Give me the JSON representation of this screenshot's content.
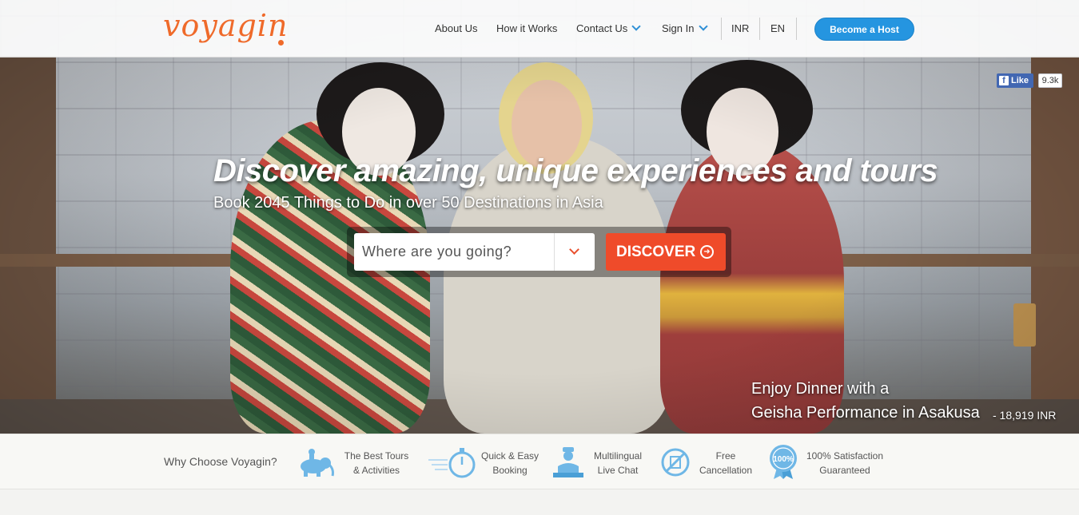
{
  "header": {
    "logo": "voyagin",
    "nav": {
      "about": "About Us",
      "how": "How it Works",
      "contact": "Contact Us",
      "sign_in": "Sign In",
      "currency": "INR",
      "language": "EN"
    },
    "host_button": "Become a Host"
  },
  "facebook": {
    "like_label": "Like",
    "count": "9.3k"
  },
  "hero": {
    "headline": "Discover amazing, unique experiences and tours",
    "subline": "Book 2045 Things to Do in over 50 Destinations in Asia",
    "search_placeholder": "Where are you going?",
    "discover_button": "DISCOVER",
    "caption_line1": "Enjoy Dinner with a",
    "caption_line2": "Geisha Performance in Asakusa",
    "caption_price": "- 18,919 INR"
  },
  "why": {
    "title": "Why Choose Voyagin?",
    "features": [
      {
        "line1": "The Best Tours",
        "line2": "& Activities",
        "icon": "elephant-icon"
      },
      {
        "line1": "Quick & Easy",
        "line2": "Booking",
        "icon": "stopwatch-icon"
      },
      {
        "line1": "Multilingual",
        "line2": "Live Chat",
        "icon": "concierge-icon"
      },
      {
        "line1": "Free",
        "line2": "Cancellation",
        "icon": "cancellation-icon"
      },
      {
        "line1": "100% Satisfaction",
        "line2": "Guaranteed",
        "icon": "satisfaction-badge-icon",
        "badge_text": "100%"
      }
    ]
  },
  "colors": {
    "brand_orange": "#ef6a2a",
    "accent_blue": "#2595e0",
    "discover_red": "#ef4b2a",
    "icon_blue": "#6fb7e6"
  }
}
